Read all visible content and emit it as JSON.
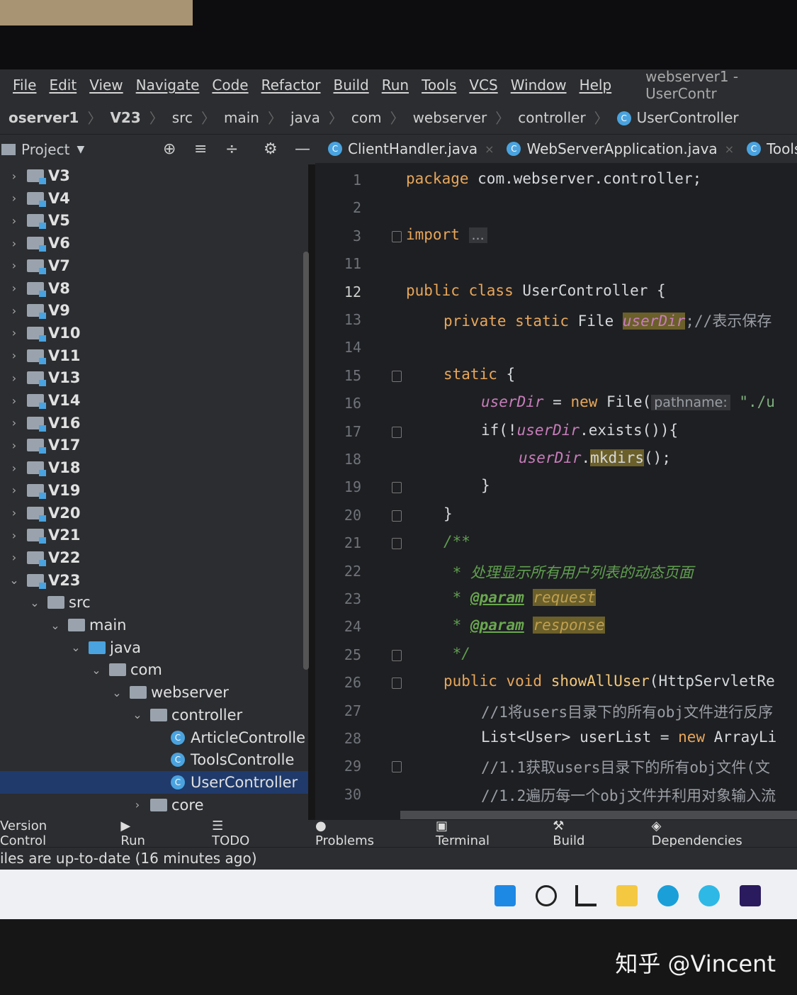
{
  "menu": {
    "items": [
      "File",
      "Edit",
      "View",
      "Navigate",
      "Code",
      "Refactor",
      "Build",
      "Run",
      "Tools",
      "VCS",
      "Window",
      "Help"
    ],
    "window_title": "webserver1 - UserContr"
  },
  "breadcrumb": [
    "oserver1",
    "V23",
    "src",
    "main",
    "java",
    "com",
    "webserver",
    "controller",
    "UserController"
  ],
  "project_panel": {
    "title": "Project"
  },
  "tree": [
    {
      "label": "V3",
      "depth": 0,
      "type": "mod",
      "open": false
    },
    {
      "label": "V4",
      "depth": 0,
      "type": "mod",
      "open": false
    },
    {
      "label": "V5",
      "depth": 0,
      "type": "mod",
      "open": false
    },
    {
      "label": "V6",
      "depth": 0,
      "type": "mod",
      "open": false
    },
    {
      "label": "V7",
      "depth": 0,
      "type": "mod",
      "open": false
    },
    {
      "label": "V8",
      "depth": 0,
      "type": "mod",
      "open": false
    },
    {
      "label": "V9",
      "depth": 0,
      "type": "mod",
      "open": false
    },
    {
      "label": "V10",
      "depth": 0,
      "type": "mod",
      "open": false
    },
    {
      "label": "V11",
      "depth": 0,
      "type": "mod",
      "open": false
    },
    {
      "label": "V13",
      "depth": 0,
      "type": "mod",
      "open": false
    },
    {
      "label": "V14",
      "depth": 0,
      "type": "mod",
      "open": false
    },
    {
      "label": "V16",
      "depth": 0,
      "type": "mod",
      "open": false
    },
    {
      "label": "V17",
      "depth": 0,
      "type": "mod",
      "open": false
    },
    {
      "label": "V18",
      "depth": 0,
      "type": "mod",
      "open": false
    },
    {
      "label": "V19",
      "depth": 0,
      "type": "mod",
      "open": false
    },
    {
      "label": "V20",
      "depth": 0,
      "type": "mod",
      "open": false
    },
    {
      "label": "V21",
      "depth": 0,
      "type": "mod",
      "open": false
    },
    {
      "label": "V22",
      "depth": 0,
      "type": "mod",
      "open": false
    },
    {
      "label": "V23",
      "depth": 0,
      "type": "mod",
      "open": true
    },
    {
      "label": "src",
      "depth": 1,
      "type": "folder",
      "open": true
    },
    {
      "label": "main",
      "depth": 2,
      "type": "folder",
      "open": true
    },
    {
      "label": "java",
      "depth": 3,
      "type": "blue",
      "open": true
    },
    {
      "label": "com",
      "depth": 4,
      "type": "folder",
      "open": true
    },
    {
      "label": "webserver",
      "depth": 5,
      "type": "folder",
      "open": true
    },
    {
      "label": "controller",
      "depth": 6,
      "type": "folder",
      "open": true
    },
    {
      "label": "ArticleControlle",
      "depth": 7,
      "type": "class"
    },
    {
      "label": "ToolsControlle",
      "depth": 7,
      "type": "class"
    },
    {
      "label": "UserController",
      "depth": 7,
      "type": "class",
      "selected": true
    },
    {
      "label": "core",
      "depth": 6,
      "type": "folder",
      "open": false
    }
  ],
  "tabs": [
    {
      "label": "ClientHandler.java"
    },
    {
      "label": "WebServerApplication.java"
    },
    {
      "label": "Tools"
    }
  ],
  "editor": {
    "current_line": "12",
    "lines": [
      {
        "n": "1",
        "ind": 0,
        "t": [
          [
            "package ",
            "kw"
          ],
          [
            "com.webserver.controller;",
            ""
          ]
        ]
      },
      {
        "n": "2",
        "ind": 0,
        "t": []
      },
      {
        "n": "3",
        "ind": 0,
        "t": [
          [
            "import ",
            "kw"
          ],
          [
            "...",
            "hint"
          ]
        ]
      },
      {
        "n": "11",
        "ind": 0,
        "t": []
      },
      {
        "n": "12",
        "ind": 0,
        "t": [
          [
            "public class ",
            "kw"
          ],
          [
            "UserController",
            ""
          ],
          [
            " {",
            ""
          ]
        ]
      },
      {
        "n": "13",
        "ind": 1,
        "t": [
          [
            "private static ",
            "kw"
          ],
          [
            "File ",
            ""
          ],
          [
            "userDir",
            "fld hl"
          ],
          [
            ";//表示保存",
            "cm"
          ]
        ]
      },
      {
        "n": "14",
        "ind": 0,
        "t": []
      },
      {
        "n": "15",
        "ind": 1,
        "t": [
          [
            "static ",
            "kw"
          ],
          [
            "{",
            ""
          ]
        ]
      },
      {
        "n": "16",
        "ind": 2,
        "t": [
          [
            "userDir",
            "fld"
          ],
          [
            " = ",
            ""
          ],
          [
            "new ",
            "kw"
          ],
          [
            "File(",
            ""
          ],
          [
            "pathname:",
            "hint"
          ],
          [
            " \"./u",
            "str"
          ]
        ]
      },
      {
        "n": "17",
        "ind": 2,
        "t": [
          [
            "if(!",
            ""
          ],
          [
            "userDir",
            "fld"
          ],
          [
            ".exists()){",
            ""
          ]
        ]
      },
      {
        "n": "18",
        "ind": 3,
        "t": [
          [
            "userDir",
            "fld"
          ],
          [
            ".",
            ""
          ],
          [
            "mkdirs",
            "hl"
          ],
          [
            "();",
            ""
          ]
        ]
      },
      {
        "n": "19",
        "ind": 2,
        "t": [
          [
            "}",
            ""
          ]
        ]
      },
      {
        "n": "20",
        "ind": 1,
        "t": [
          [
            "}",
            ""
          ]
        ]
      },
      {
        "n": "21",
        "ind": 1,
        "t": [
          [
            "/**",
            "doc"
          ]
        ]
      },
      {
        "n": "22",
        "ind": 1,
        "t": [
          [
            " * 处理显示所有用户列表的动态页面",
            "doc"
          ]
        ]
      },
      {
        "n": "23",
        "ind": 1,
        "t": [
          [
            " * ",
            "doc"
          ],
          [
            "@param",
            "tag"
          ],
          [
            " ",
            ""
          ],
          [
            "request",
            "dochl"
          ]
        ]
      },
      {
        "n": "24",
        "ind": 1,
        "t": [
          [
            " * ",
            "doc"
          ],
          [
            "@param",
            "tag"
          ],
          [
            " ",
            ""
          ],
          [
            "response",
            "dochl"
          ]
        ]
      },
      {
        "n": "25",
        "ind": 1,
        "t": [
          [
            " */",
            "doc"
          ]
        ]
      },
      {
        "n": "26",
        "ind": 1,
        "t": [
          [
            "public void ",
            "kw"
          ],
          [
            "showAllUser",
            "fn"
          ],
          [
            "(HttpServletRe",
            ""
          ]
        ]
      },
      {
        "n": "27",
        "ind": 2,
        "t": [
          [
            "//1将users目录下的所有obj文件进行反序",
            "cm"
          ]
        ]
      },
      {
        "n": "28",
        "ind": 2,
        "t": [
          [
            "List<User> userList = ",
            ""
          ],
          [
            "new ",
            "kw"
          ],
          [
            "ArrayLi",
            ""
          ]
        ]
      },
      {
        "n": "29",
        "ind": 2,
        "t": [
          [
            "//1.1获取users目录下的所有obj文件(文",
            "cm"
          ]
        ]
      },
      {
        "n": "30",
        "ind": 2,
        "t": [
          [
            "//1.2遍历每一个obj文件并利用对象输入流",
            "cm"
          ]
        ]
      }
    ]
  },
  "bottom_tools": [
    "Version Control",
    "Run",
    "TODO",
    "Problems",
    "Terminal",
    "Build",
    "Dependencies"
  ],
  "status": "iles are up-to-date (16 minutes ago)",
  "watermark": "知乎 @Vincent"
}
